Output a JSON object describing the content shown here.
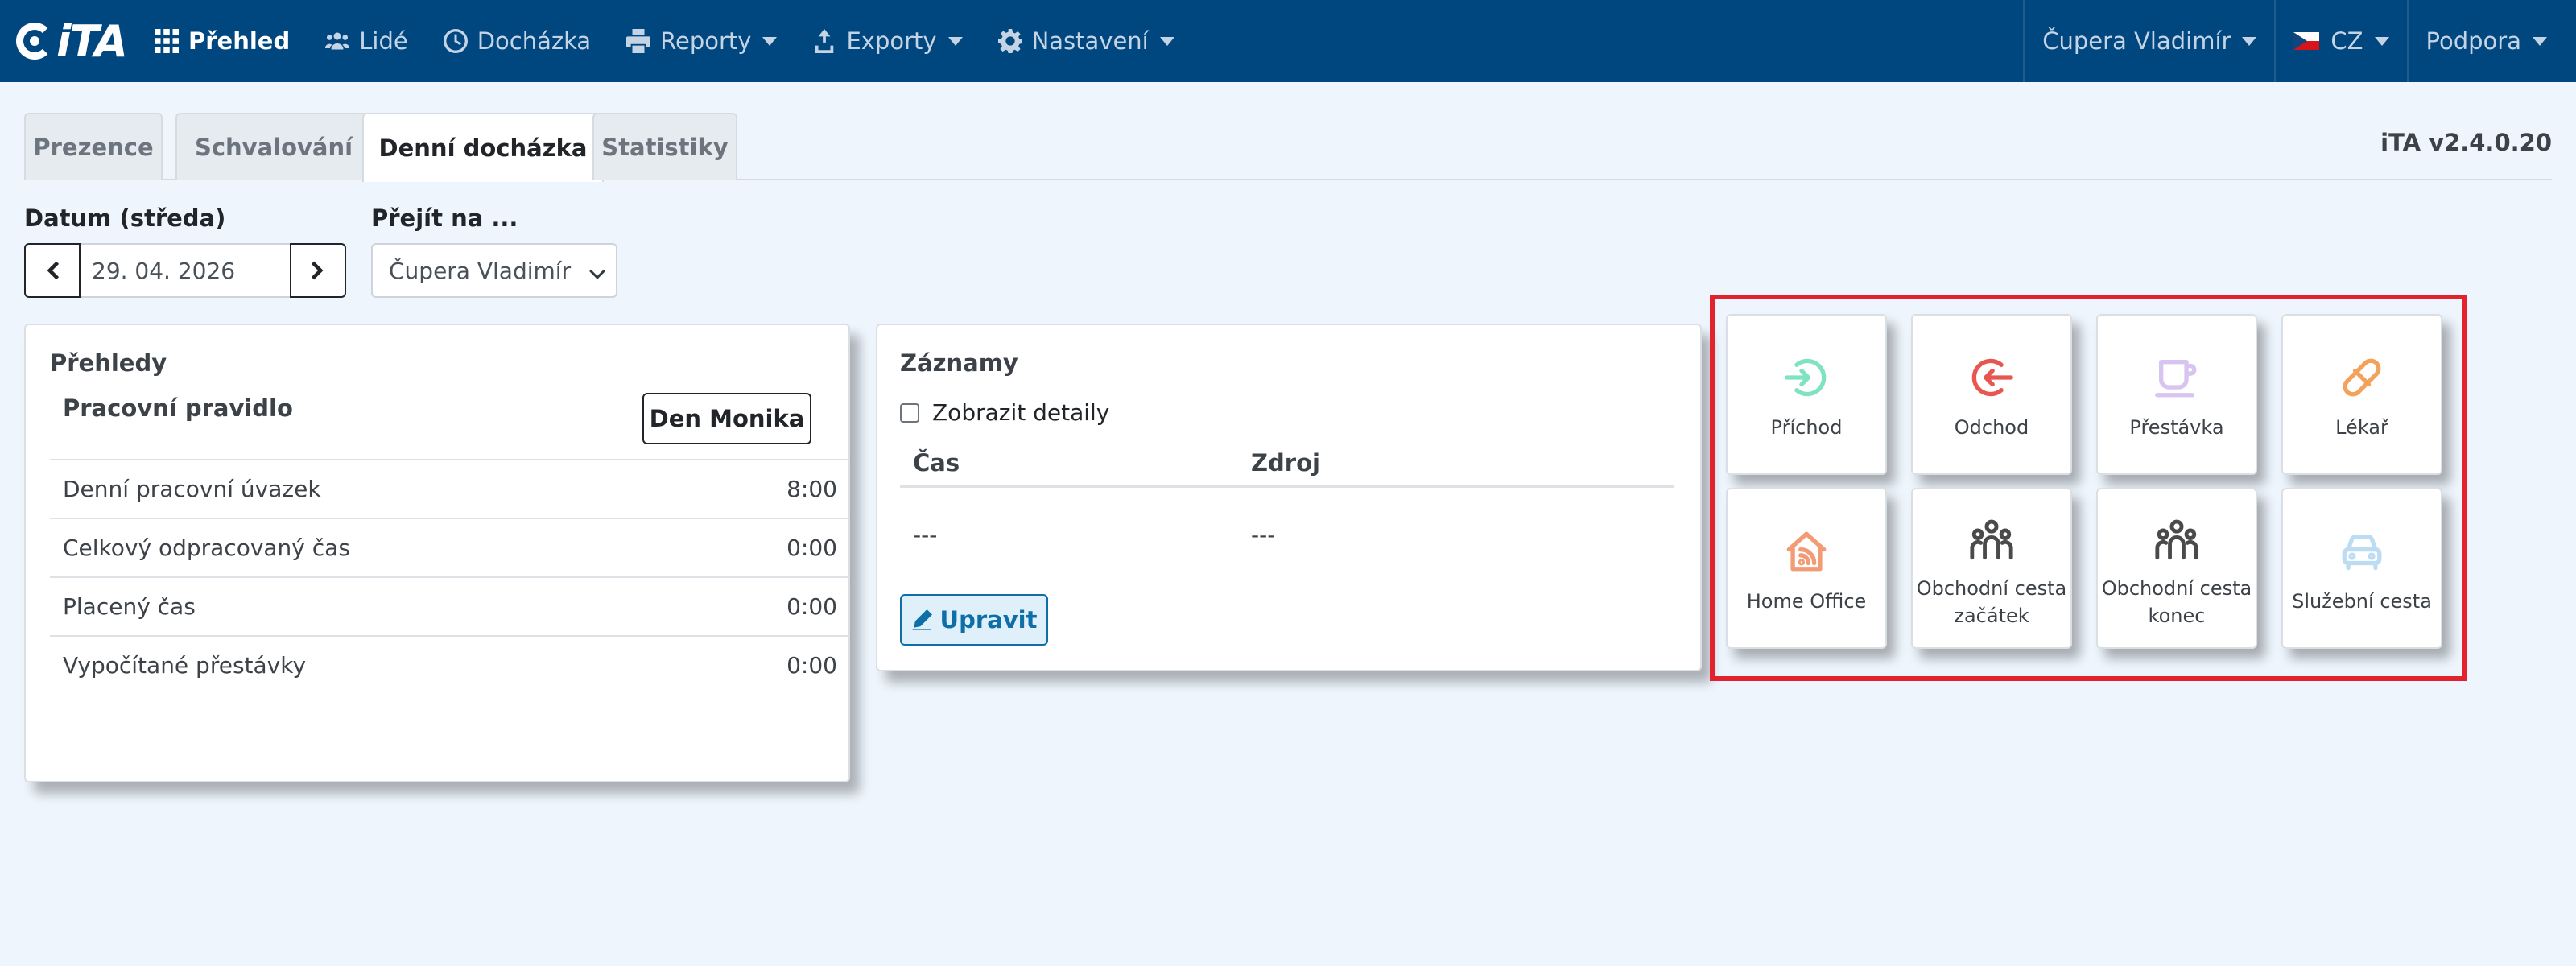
{
  "app": {
    "brand": "iTA",
    "version": "iTA v2.4.0.20"
  },
  "navbar": {
    "items": [
      {
        "label": "Přehled",
        "icon": "grid-icon"
      },
      {
        "label": "Lidé",
        "icon": "users-icon"
      },
      {
        "label": "Docházka",
        "icon": "clock-icon"
      },
      {
        "label": "Reporty",
        "icon": "printer-icon"
      },
      {
        "label": "Exporty",
        "icon": "export-icon"
      },
      {
        "label": "Nastavení",
        "icon": "gear-icon"
      }
    ],
    "user": "Čupera Vladimír",
    "language": "CZ",
    "support": "Podpora"
  },
  "tabs": [
    "Prezence",
    "Schvalování",
    "Denní docházka",
    "Statistiky"
  ],
  "active_tab": "Denní docházka",
  "date": {
    "label": "Datum (středa)",
    "value": "29. 04. 2026"
  },
  "goto": {
    "label": "Přejít na ...",
    "selected": "Čupera Vladimír"
  },
  "prehledy": {
    "title": "Přehledy",
    "rule_label": "Pracovní pravidlo",
    "rule_button": "Den Monika",
    "rows": [
      {
        "label": "Denní pracovní úvazek",
        "value": "8:00"
      },
      {
        "label": "Celkový odpracovaný čas",
        "value": "0:00"
      },
      {
        "label": "Placený čas",
        "value": "0:00"
      },
      {
        "label": "Vypočítané přestávky",
        "value": "0:00"
      }
    ]
  },
  "zaznamy": {
    "title": "Záznamy",
    "details_label": "Zobrazit detaily",
    "columns": [
      "Čas",
      "Zdroj"
    ],
    "row": [
      "---",
      "---"
    ],
    "edit_button": "Upravit"
  },
  "actions": [
    {
      "line1": "Příchod",
      "line2": "",
      "icon": "arrival-icon",
      "color": "#7fe3c2"
    },
    {
      "line1": "Odchod",
      "line2": "",
      "icon": "departure-icon",
      "color": "#e8574f"
    },
    {
      "line1": "Přestávka",
      "line2": "",
      "icon": "coffee-icon",
      "color": "#d8c4f0"
    },
    {
      "line1": "Lékař",
      "line2": "",
      "icon": "pill-icon",
      "color": "#f4a25a"
    },
    {
      "line1": "Home Office",
      "line2": "",
      "icon": "home-office-icon",
      "color": "#f29b74"
    },
    {
      "line1": "Obchodní cesta",
      "line2": "začátek",
      "icon": "group-icon",
      "color": "#4a4a4a"
    },
    {
      "line1": "Obchodní cesta",
      "line2": "konec",
      "icon": "group-icon",
      "color": "#4a4a4a"
    },
    {
      "line1": "Služební cesta",
      "line2": "",
      "icon": "car-icon",
      "color": "#bcdcf4"
    }
  ],
  "colors": {
    "navbar": "#00467f",
    "highlight": "#e2232e",
    "accent": "#0d6ea8"
  }
}
